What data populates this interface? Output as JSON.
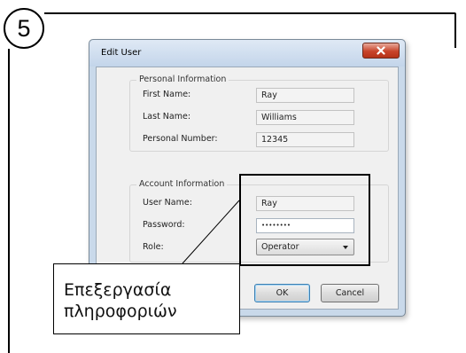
{
  "step": {
    "number": "5"
  },
  "dialog": {
    "title": "Edit User",
    "close_icon": "close-icon",
    "personal": {
      "legend": "Personal Information",
      "first_name_label": "First Name:",
      "first_name_value": "Ray",
      "last_name_label": "Last Name:",
      "last_name_value": "Williams",
      "personal_number_label": "Personal Number:",
      "personal_number_value": "12345"
    },
    "account": {
      "legend": "Account Information",
      "user_name_label": "User Name:",
      "user_name_value": "Ray",
      "password_label": "Password:",
      "password_value": "••••••••",
      "role_label": "Role:",
      "role_value": "Operator"
    },
    "ok_label": "OK",
    "cancel_label": "Cancel"
  },
  "callout": {
    "line1": "Επεξεργασία",
    "line2": "πληροφοριών"
  },
  "colors": {
    "dialog_frame": "#c9d9ea",
    "close_button": "#c8442b",
    "client_bg": "#f0f0f0"
  }
}
